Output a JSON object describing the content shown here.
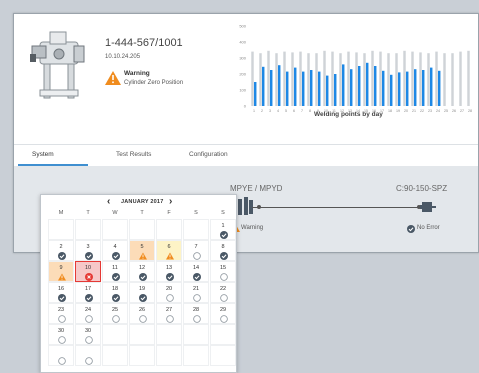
{
  "device": {
    "id": "1-444-567/1001",
    "ip": "10.10.24.205",
    "warning_title": "Warning",
    "warning_text": "Cylinder Zero Position"
  },
  "chart_data": {
    "type": "bar",
    "categories": [
      "1",
      "2",
      "3",
      "4",
      "5",
      "6",
      "7",
      "8",
      "9",
      "10",
      "11",
      "12",
      "13",
      "14",
      "15",
      "16",
      "17",
      "18",
      "19",
      "20",
      "21",
      "22",
      "23",
      "24",
      "25",
      "26",
      "27",
      "28"
    ],
    "series": [
      {
        "values": [
          340,
          330,
          345,
          330,
          340,
          335,
          340,
          330,
          330,
          345,
          340,
          330,
          340,
          335,
          330,
          345,
          340,
          330,
          330,
          345,
          340,
          335,
          330,
          340,
          330,
          330,
          340,
          345
        ],
        "color": "#cfd3d7"
      },
      {
        "values": [
          150,
          245,
          225,
          255,
          215,
          240,
          215,
          225,
          215,
          190,
          200,
          260,
          230,
          250,
          270,
          250,
          220,
          195,
          210,
          215,
          230,
          225,
          240,
          220,
          0,
          0,
          0,
          0
        ],
        "color": "#1e88e5"
      }
    ],
    "yticks": [
      "0",
      "100",
      "200",
      "300",
      "400",
      "500"
    ],
    "ylim": [
      0,
      500
    ],
    "xlabel": "Welding points by day",
    "grid": false
  },
  "tabs": [
    "System",
    "Test Results",
    "Configuration"
  ],
  "connection": {
    "left_label": "MPYE / MPYD",
    "right_label": "C:90-150-SPZ",
    "left_status": "Warning",
    "right_status": "No Error"
  },
  "calendar": {
    "month": "JANUARY 2017",
    "weekdays": [
      "M",
      "T",
      "W",
      "T",
      "F",
      "S",
      "S"
    ],
    "rows": [
      [
        {
          "d": "",
          "s": "empty"
        },
        {
          "d": "",
          "s": "empty"
        },
        {
          "d": "",
          "s": "empty"
        },
        {
          "d": "",
          "s": "empty"
        },
        {
          "d": "",
          "s": "empty"
        },
        {
          "d": "",
          "s": "empty"
        },
        {
          "d": "1",
          "s": "ok"
        }
      ],
      [
        {
          "d": "2",
          "s": "ok"
        },
        {
          "d": "3",
          "s": "ok"
        },
        {
          "d": "4",
          "s": "ok"
        },
        {
          "d": "5",
          "s": "warn",
          "bg": "warning"
        },
        {
          "d": "6",
          "s": "warn",
          "bg": "highlight"
        },
        {
          "d": "7",
          "s": "open"
        },
        {
          "d": "8",
          "s": "ok"
        }
      ],
      [
        {
          "d": "9",
          "s": "warn",
          "bg": "warning"
        },
        {
          "d": "10",
          "s": "error",
          "bg": "selected"
        },
        {
          "d": "11",
          "s": "ok"
        },
        {
          "d": "12",
          "s": "ok"
        },
        {
          "d": "13",
          "s": "ok"
        },
        {
          "d": "14",
          "s": "ok"
        },
        {
          "d": "15",
          "s": "open"
        }
      ],
      [
        {
          "d": "16",
          "s": "ok"
        },
        {
          "d": "17",
          "s": "ok"
        },
        {
          "d": "18",
          "s": "ok"
        },
        {
          "d": "19",
          "s": "ok"
        },
        {
          "d": "20",
          "s": "open"
        },
        {
          "d": "21",
          "s": "open"
        },
        {
          "d": "22",
          "s": "open"
        }
      ],
      [
        {
          "d": "23",
          "s": "open"
        },
        {
          "d": "24",
          "s": "open"
        },
        {
          "d": "25",
          "s": "open"
        },
        {
          "d": "26",
          "s": "open"
        },
        {
          "d": "27",
          "s": "open"
        },
        {
          "d": "28",
          "s": "open"
        },
        {
          "d": "29",
          "s": "open"
        }
      ],
      [
        {
          "d": "30",
          "s": "open"
        },
        {
          "d": "30",
          "s": "open"
        },
        {
          "d": "",
          "s": "empty"
        },
        {
          "d": "",
          "s": "empty"
        },
        {
          "d": "",
          "s": "empty"
        },
        {
          "d": "",
          "s": "empty"
        },
        {
          "d": "",
          "s": "empty"
        }
      ],
      [
        {
          "d": "",
          "s": "open"
        },
        {
          "d": "",
          "s": "open"
        },
        {
          "d": "",
          "s": "empty"
        },
        {
          "d": "",
          "s": "empty"
        },
        {
          "d": "",
          "s": "empty"
        },
        {
          "d": "",
          "s": "empty"
        },
        {
          "d": "",
          "s": "empty"
        }
      ]
    ]
  },
  "colors": {
    "accent": "#3f8fd0",
    "warning": "#f08c1e",
    "error": "#e53935",
    "ok": "#4a5866"
  }
}
